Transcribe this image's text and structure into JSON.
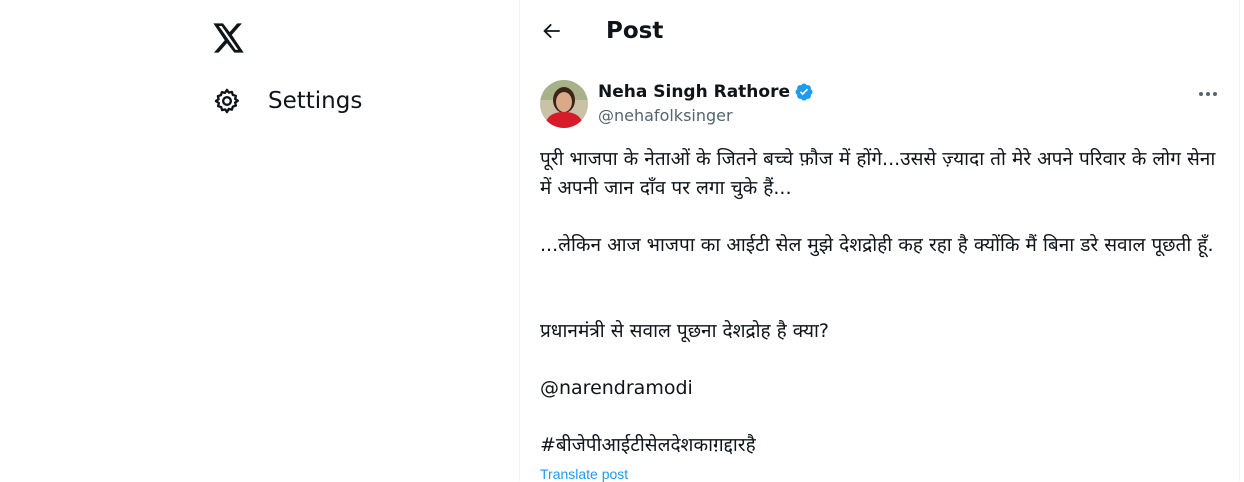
{
  "sidebar": {
    "logo_icon": "x-logo-icon",
    "settings_label": "Settings",
    "settings_icon": "gear-icon"
  },
  "header": {
    "back_icon": "arrow-left-icon",
    "title": "Post"
  },
  "post": {
    "author": {
      "display_name": "Neha Singh Rathore",
      "handle": "@nehafolksinger",
      "verified": true,
      "verified_color": "#1d9bf0"
    },
    "paragraphs": [
      "पूरी भाजपा के नेताओं के जितने बच्चे फ़ौज में होंगे...उससे ज़्यादा तो मेरे अपने परिवार के लोग सेना में अपनी जान दाँव पर लगा चुके हैं...",
      "...लेकिन आज भाजपा का आईटी सेल मुझे देशद्रोही कह रहा है क्योंकि मैं बिना डरे सवाल पूछती हूँ.",
      "प्रधानमंत्री से सवाल पूछना देशद्रोह है क्या?"
    ],
    "mention": "@narendramodi",
    "hashtag": "#बीजेपीआईटीसेलदेशकाग़द्दारहै",
    "translate_label": "Translate post",
    "link_color": "#1d9bf0"
  }
}
